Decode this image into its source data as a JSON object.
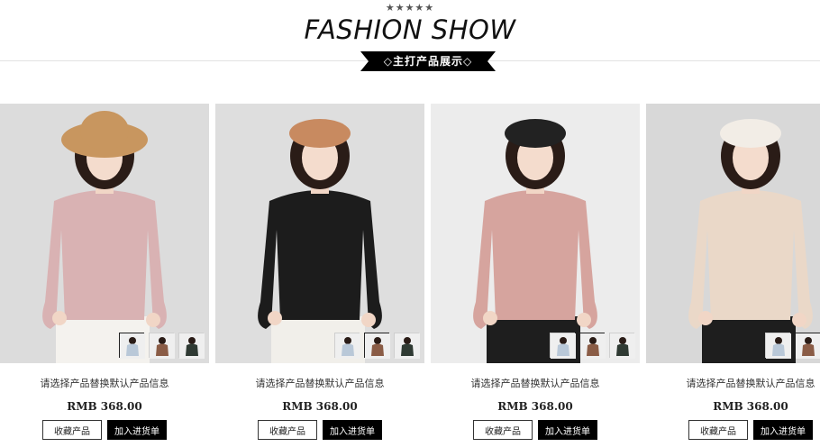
{
  "header": {
    "stars": "★★★★★",
    "title": "FASHION SHOW",
    "subtitle": "◇主打产品展示◇"
  },
  "products": [
    {
      "name": "请选择产品替换默认产品信息",
      "price": "RMB 368.00",
      "fav_label": "收藏产品",
      "cart_label": "加入进货单",
      "colors": {
        "bg": "#dcdcdc",
        "top": "#d9b2b3",
        "skirt": "#f4f2ee",
        "hat": "#c8965f",
        "hat_type": "wide"
      }
    },
    {
      "name": "请选择产品替换默认产品信息",
      "price": "RMB 368.00",
      "fav_label": "收藏产品",
      "cart_label": "加入进货单",
      "colors": {
        "bg": "#dedede",
        "top": "#1c1c1c",
        "skirt": "#f1efea",
        "hat": "#c88a60",
        "hat_type": "beret"
      }
    },
    {
      "name": "请选择产品替换默认产品信息",
      "price": "RMB 368.00",
      "fav_label": "收藏产品",
      "cart_label": "加入进货单",
      "colors": {
        "bg": "#ececec",
        "top": "#d6a49e",
        "skirt": "#1e1e1e",
        "hat": "#222222",
        "hat_type": "beret"
      }
    },
    {
      "name": "请选择产品替换默认产品信息",
      "price": "RMB 368.00",
      "fav_label": "收藏产品",
      "cart_label": "加入进货单",
      "colors": {
        "bg": "#d8d8d8",
        "top": "#ead8c8",
        "skirt": "#1e1e1e",
        "hat": "#f2ede6",
        "hat_type": "beret"
      }
    }
  ],
  "thumb_colors": [
    "#b9c8d8",
    "#8a5c46",
    "#2f3a33"
  ],
  "icons": {
    "ribbon": "ribbon-banner",
    "thumb": "swatch-thumbnail"
  }
}
